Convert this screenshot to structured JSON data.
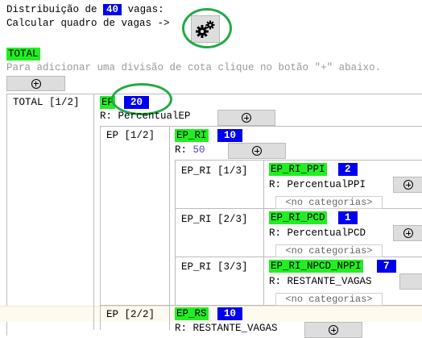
{
  "header": {
    "distribuicao_label": "Distribuição de",
    "total_vagas": "40",
    "vagas_label": "vagas:",
    "calcular_label": "Calcular quadro de vagas ->"
  },
  "total_tag": "TOTAL",
  "instruction": "Para adicionar uma divisão de cota clique no botão \"+\" abaixo.",
  "tree": {
    "root_label": "TOTAL [1/2]",
    "ep": {
      "tag": "EP",
      "count": "20",
      "rule": "R: PercentualEP"
    },
    "ep1": {
      "label": "EP [1/2]",
      "tag": "EP_RI",
      "count": "10",
      "rule_prefix": "R:",
      "rule_value": "50",
      "children": [
        {
          "label": "EP_RI [1/3]",
          "tag": "EP_RI_PPI",
          "count": "2",
          "rule": "R: PercentualPPI",
          "select": "<no categorias>"
        },
        {
          "label": "EP_RI [2/3]",
          "tag": "EP_RI_PCD",
          "count": "1",
          "rule": "R: PercentualPCD",
          "select": "<no categorias>"
        },
        {
          "label": "EP_RI [3/3]",
          "tag": "EP_RI_NPCD_NPPI",
          "count": "7",
          "rule": "R: RESTANTE_VAGAS",
          "select": "<no categorias>"
        }
      ]
    },
    "ep2": {
      "label": "EP [2/2]",
      "tag": "EP_RS",
      "count": "10",
      "rule": "R: RESTANTE_VAGAS"
    }
  },
  "icons": {
    "calculate": "gears-icon",
    "add": "plus-circle-icon"
  },
  "colors": {
    "tag_green": "#22ee22",
    "tag_blue": "#0000ee",
    "highlight_ring": "#22aa44"
  }
}
